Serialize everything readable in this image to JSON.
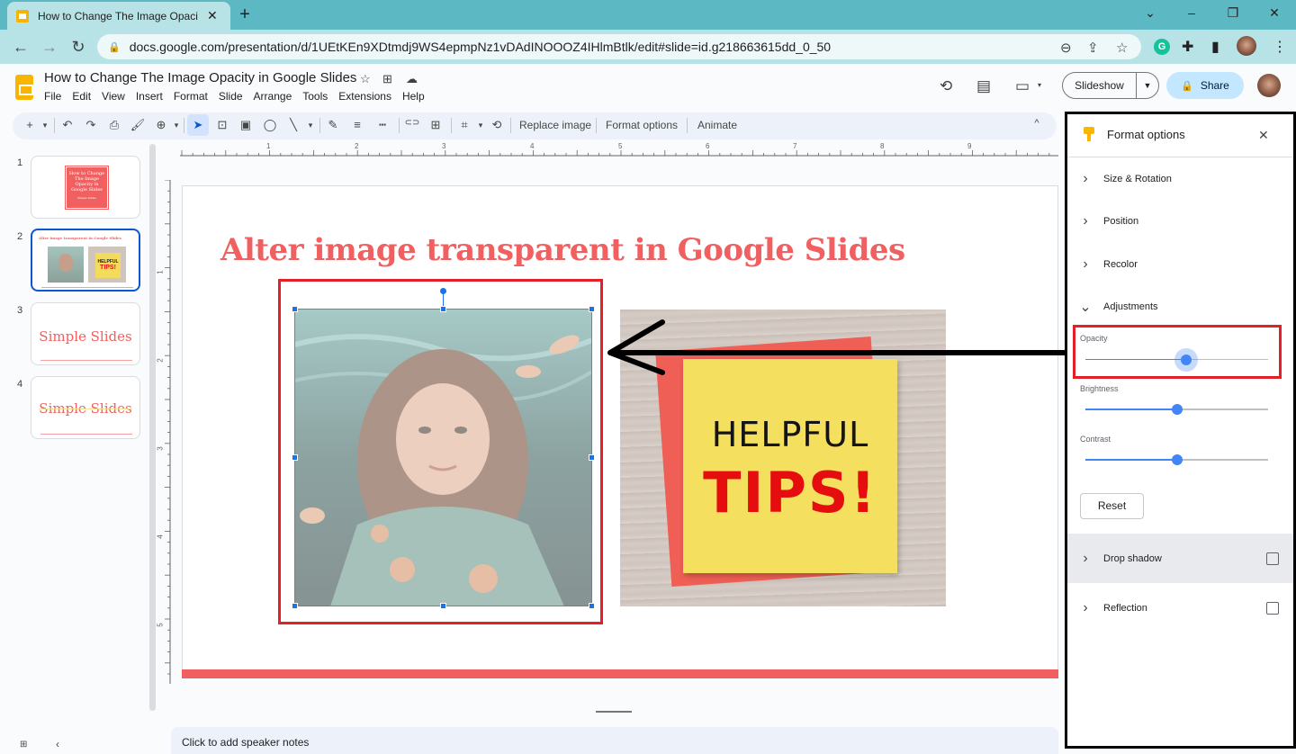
{
  "browser": {
    "tab_title": "How to Change The Image Opaci",
    "tab_close": "✕",
    "new_tab": "+",
    "window_controls": {
      "tab_search": "⌄",
      "minimize": "–",
      "restore": "❐",
      "close": "✕"
    },
    "nav": {
      "back": "←",
      "forward": "→",
      "reload": "↻"
    },
    "url": "docs.google.com/presentation/d/1UEtKEn9XDtmdj9WS4epmpNz1vDAdINOOOZ4IHlmBtlk/edit#slide=id.g218663615dd_0_50",
    "omnibox_icons": {
      "lock": "🔒",
      "zoom": "⊖",
      "share": "⇪",
      "bookmark": "☆"
    },
    "extensions": {
      "grammarly": "G",
      "puzzle": "✚",
      "sidepanel": "▮",
      "menu": "⋮"
    }
  },
  "doc": {
    "title": "How to Change The Image Opacity in Google Slides",
    "title_icons": {
      "star": "☆",
      "move": "⊞",
      "cloud": "☁"
    },
    "menu": [
      "File",
      "Edit",
      "View",
      "Insert",
      "Format",
      "Slide",
      "Arrange",
      "Tools",
      "Extensions",
      "Help"
    ],
    "header_icons": {
      "history": "⟲",
      "comments": "▤",
      "meet": "▭"
    },
    "slideshow_label": "Slideshow",
    "slideshow_dropdown": "▼",
    "share_label": "Share",
    "share_lock": "🔒"
  },
  "toolbar": {
    "icons": {
      "new": "+",
      "new_dd": "▾",
      "undo": "↶",
      "redo": "↷",
      "print": "⎙",
      "paint": "🖌",
      "zoom": "⊕",
      "zoom_dd": "▾",
      "select": "➤",
      "textbox": "⊡",
      "image": "▣",
      "shape": "◯",
      "line": "╲",
      "line_dd": "▾",
      "pen": "✎",
      "weight": "≡",
      "dash": "┅",
      "link": "⊂⊃",
      "comment": "⊞",
      "crop": "⌗",
      "crop_dd": "▾",
      "reset_image": "⟲",
      "collapse": "^"
    },
    "replace_image": "Replace image",
    "format_options": "Format options",
    "animate": "Animate"
  },
  "ruler": {
    "horizontal": [
      "1",
      "2",
      "3",
      "4",
      "5",
      "6",
      "7",
      "8",
      "9"
    ],
    "vertical": [
      "1",
      "2",
      "3",
      "4",
      "5"
    ]
  },
  "filmstrip": [
    {
      "num": "1",
      "text": "How to Change The Image Opacity in Google Slides",
      "sub": "Simple Slides"
    },
    {
      "num": "2",
      "text": "Alter image transparent in Google Slides",
      "helpful": "HELPFUL",
      "tips": "TIPS!"
    },
    {
      "num": "3",
      "text": "Simple Slides"
    },
    {
      "num": "4",
      "text": "Simple Slides"
    }
  ],
  "slide": {
    "title": "Alter image transparent in Google Slides",
    "sticky_line1": "HELPFUL",
    "sticky_line2": "TIPS!",
    "accent_color": "#f06060"
  },
  "notes_placeholder": "Click to add speaker notes",
  "bottom_icons": {
    "grid": "⊞",
    "collapse": "‹"
  },
  "format_panel": {
    "title": "Format options",
    "close": "✕",
    "sections": [
      {
        "label": "Size & Rotation",
        "expanded": false
      },
      {
        "label": "Position",
        "expanded": false
      },
      {
        "label": "Recolor",
        "expanded": false
      },
      {
        "label": "Adjustments",
        "expanded": true
      }
    ],
    "adjustments": {
      "opacity_label": "Opacity",
      "opacity_value": 0.55,
      "brightness_label": "Brightness",
      "brightness_value": 0.5,
      "contrast_label": "Contrast",
      "contrast_value": 0.5,
      "reset_label": "Reset"
    },
    "drop_shadow": {
      "label": "Drop shadow",
      "checked": false
    },
    "reflection": {
      "label": "Reflection",
      "checked": false
    },
    "chevron_right": "›",
    "chevron_down": "⌄"
  }
}
